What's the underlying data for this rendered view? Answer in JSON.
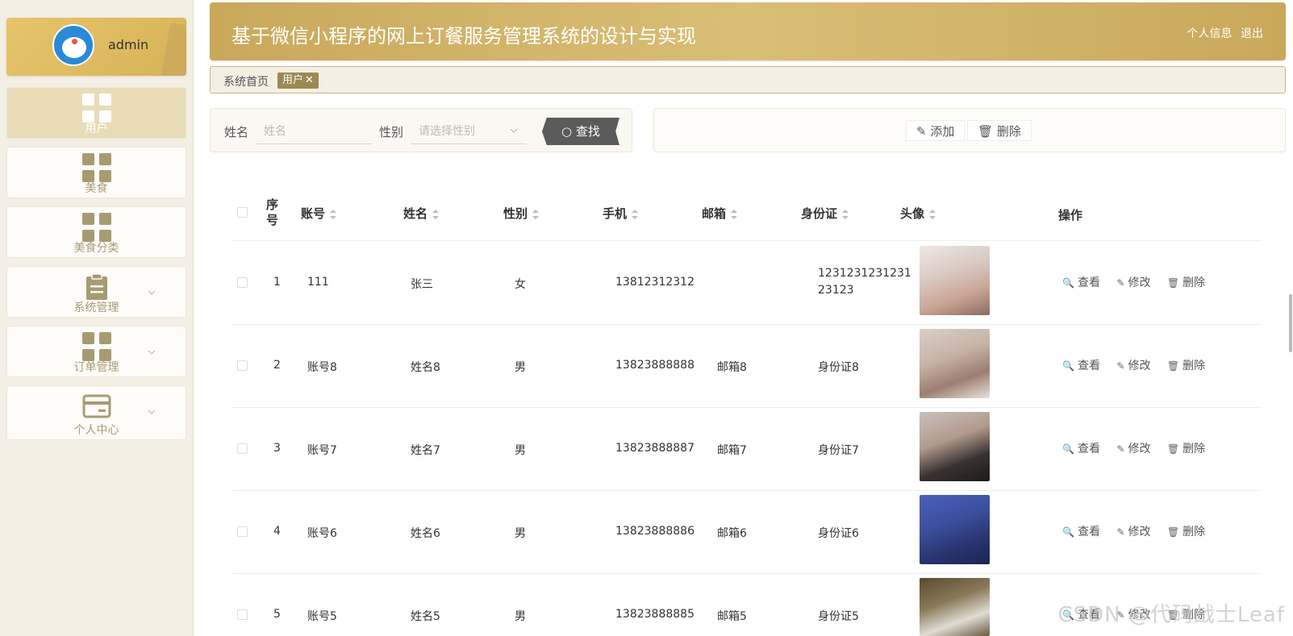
{
  "user": {
    "name": "admin"
  },
  "menu": [
    {
      "label": "用户",
      "icon": "grid-icon",
      "active": true
    },
    {
      "label": "美食",
      "icon": "grid-icon"
    },
    {
      "label": "美食分类",
      "icon": "grid-icon"
    },
    {
      "label": "系统管理",
      "icon": "clipboard-icon"
    },
    {
      "label": "订单管理",
      "icon": "grid-icon"
    },
    {
      "label": "个人中心",
      "icon": "card-icon"
    }
  ],
  "header": {
    "title": "基于微信小程序的网上订餐服务管理系统的设计与实现",
    "profile_link": "个人信息",
    "logout_link": "退出"
  },
  "tabs": {
    "home": "系统首页",
    "current": "用户",
    "close": "✕"
  },
  "search": {
    "name_label": "姓名",
    "name_placeholder": "姓名",
    "gender_label": "性别",
    "gender_placeholder": "请选择性别",
    "button": "查找"
  },
  "actions": {
    "add": "添加",
    "delete": "删除"
  },
  "table": {
    "headers": [
      "序号",
      "账号",
      "姓名",
      "性别",
      "手机",
      "邮箱",
      "身份证",
      "头像",
      "操作"
    ],
    "rows": [
      {
        "index": "1",
        "account": "111",
        "name": "张三",
        "gender": "女",
        "phone": "13812312312",
        "email": "",
        "id_line1": "1231231231231",
        "id_line2": "23123"
      },
      {
        "index": "2",
        "account": "账号8",
        "name": "姓名8",
        "gender": "男",
        "phone": "13823888888",
        "email": "邮箱8",
        "id_line1": "身份证8",
        "id_line2": ""
      },
      {
        "index": "3",
        "account": "账号7",
        "name": "姓名7",
        "gender": "男",
        "phone": "13823888887",
        "email": "邮箱7",
        "id_line1": "身份证7",
        "id_line2": ""
      },
      {
        "index": "4",
        "account": "账号6",
        "name": "姓名6",
        "gender": "男",
        "phone": "13823888886",
        "email": "邮箱6",
        "id_line1": "身份证6",
        "id_line2": ""
      },
      {
        "index": "5",
        "account": "账号5",
        "name": "姓名5",
        "gender": "男",
        "phone": "13823888885",
        "email": "邮箱5",
        "id_line1": "身份证5",
        "id_line2": ""
      }
    ],
    "ops": {
      "view": "查看",
      "edit": "修改",
      "delete": "删除"
    }
  },
  "watermark": "CSDN @代码战士Leaf",
  "colors": {
    "accent": "#c9a85a",
    "sidebar": "#f3efe4",
    "button_dark": "#5b5b5b"
  }
}
